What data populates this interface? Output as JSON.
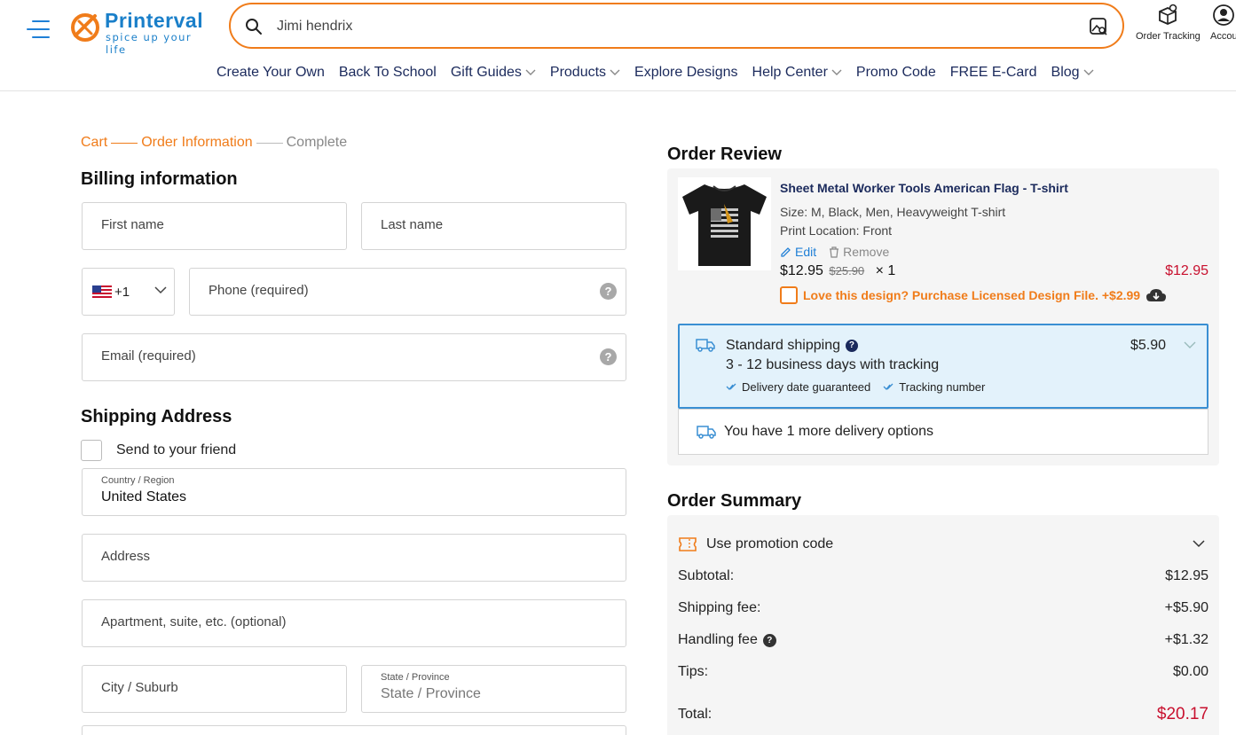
{
  "header": {
    "brand": "Printerval",
    "slogan": "spice up your life",
    "search_value": "Jimi hendrix",
    "order_tracking": "Order Tracking",
    "account": "Accou"
  },
  "nav": [
    {
      "label": "Create Your Own",
      "dropdown": false
    },
    {
      "label": "Back To School",
      "dropdown": false
    },
    {
      "label": "Gift Guides",
      "dropdown": true
    },
    {
      "label": "Products",
      "dropdown": true
    },
    {
      "label": "Explore Designs",
      "dropdown": false
    },
    {
      "label": "Help Center",
      "dropdown": true
    },
    {
      "label": "Promo Code",
      "dropdown": false
    },
    {
      "label": "FREE E-Card",
      "dropdown": false
    },
    {
      "label": "Blog",
      "dropdown": true
    }
  ],
  "steps": {
    "cart": "Cart",
    "order_info": "Order Information",
    "complete": "Complete"
  },
  "billing": {
    "title": "Billing information",
    "first_name": "First name",
    "last_name": "Last name",
    "phone_code": "+1",
    "phone": "Phone (required)",
    "email": "Email (required)"
  },
  "shipping": {
    "title": "Shipping Address",
    "send_friend": "Send to your friend",
    "country_label": "Country / Region",
    "country_value": "United States",
    "address": "Address",
    "apartment": "Apartment, suite, etc. (optional)",
    "city": "City / Suburb",
    "state_label": "State / Province",
    "state_value": "State / Province"
  },
  "review": {
    "title": "Order Review",
    "product_title": "Sheet Metal Worker Tools American Flag - T-shirt",
    "size_line": "Size: M, Black, Men, Heavyweight T-shirt",
    "location_line": "Print Location: Front",
    "edit": "Edit",
    "remove": "Remove",
    "price": "$12.95",
    "old_price": "$25.90",
    "qty": "× 1",
    "line_total": "$12.95",
    "license": "Love this design? Purchase Licensed Design File. +$2.99"
  },
  "ship_option": {
    "name": "Standard shipping",
    "days": "3 - 12 business days with tracking",
    "badge1": "Delivery date guaranteed",
    "badge2": "Tracking number",
    "price": "$5.90",
    "more": "You have 1 more delivery options"
  },
  "summary": {
    "title": "Order Summary",
    "promo": "Use promotion code",
    "subtotal_label": "Subtotal:",
    "subtotal": "$12.95",
    "shipping_label": "Shipping fee:",
    "shipping": "+$5.90",
    "handling_label": "Handling fee",
    "handling": "+$1.32",
    "tips_label": "Tips:",
    "tips": "$0.00",
    "total_label": "Total:",
    "total": "$20.17"
  },
  "colors": {
    "accent": "#f07c1a",
    "brand_blue": "#1a7fc9",
    "nav_text": "#1b2a5c",
    "price_red": "#c8102e"
  }
}
